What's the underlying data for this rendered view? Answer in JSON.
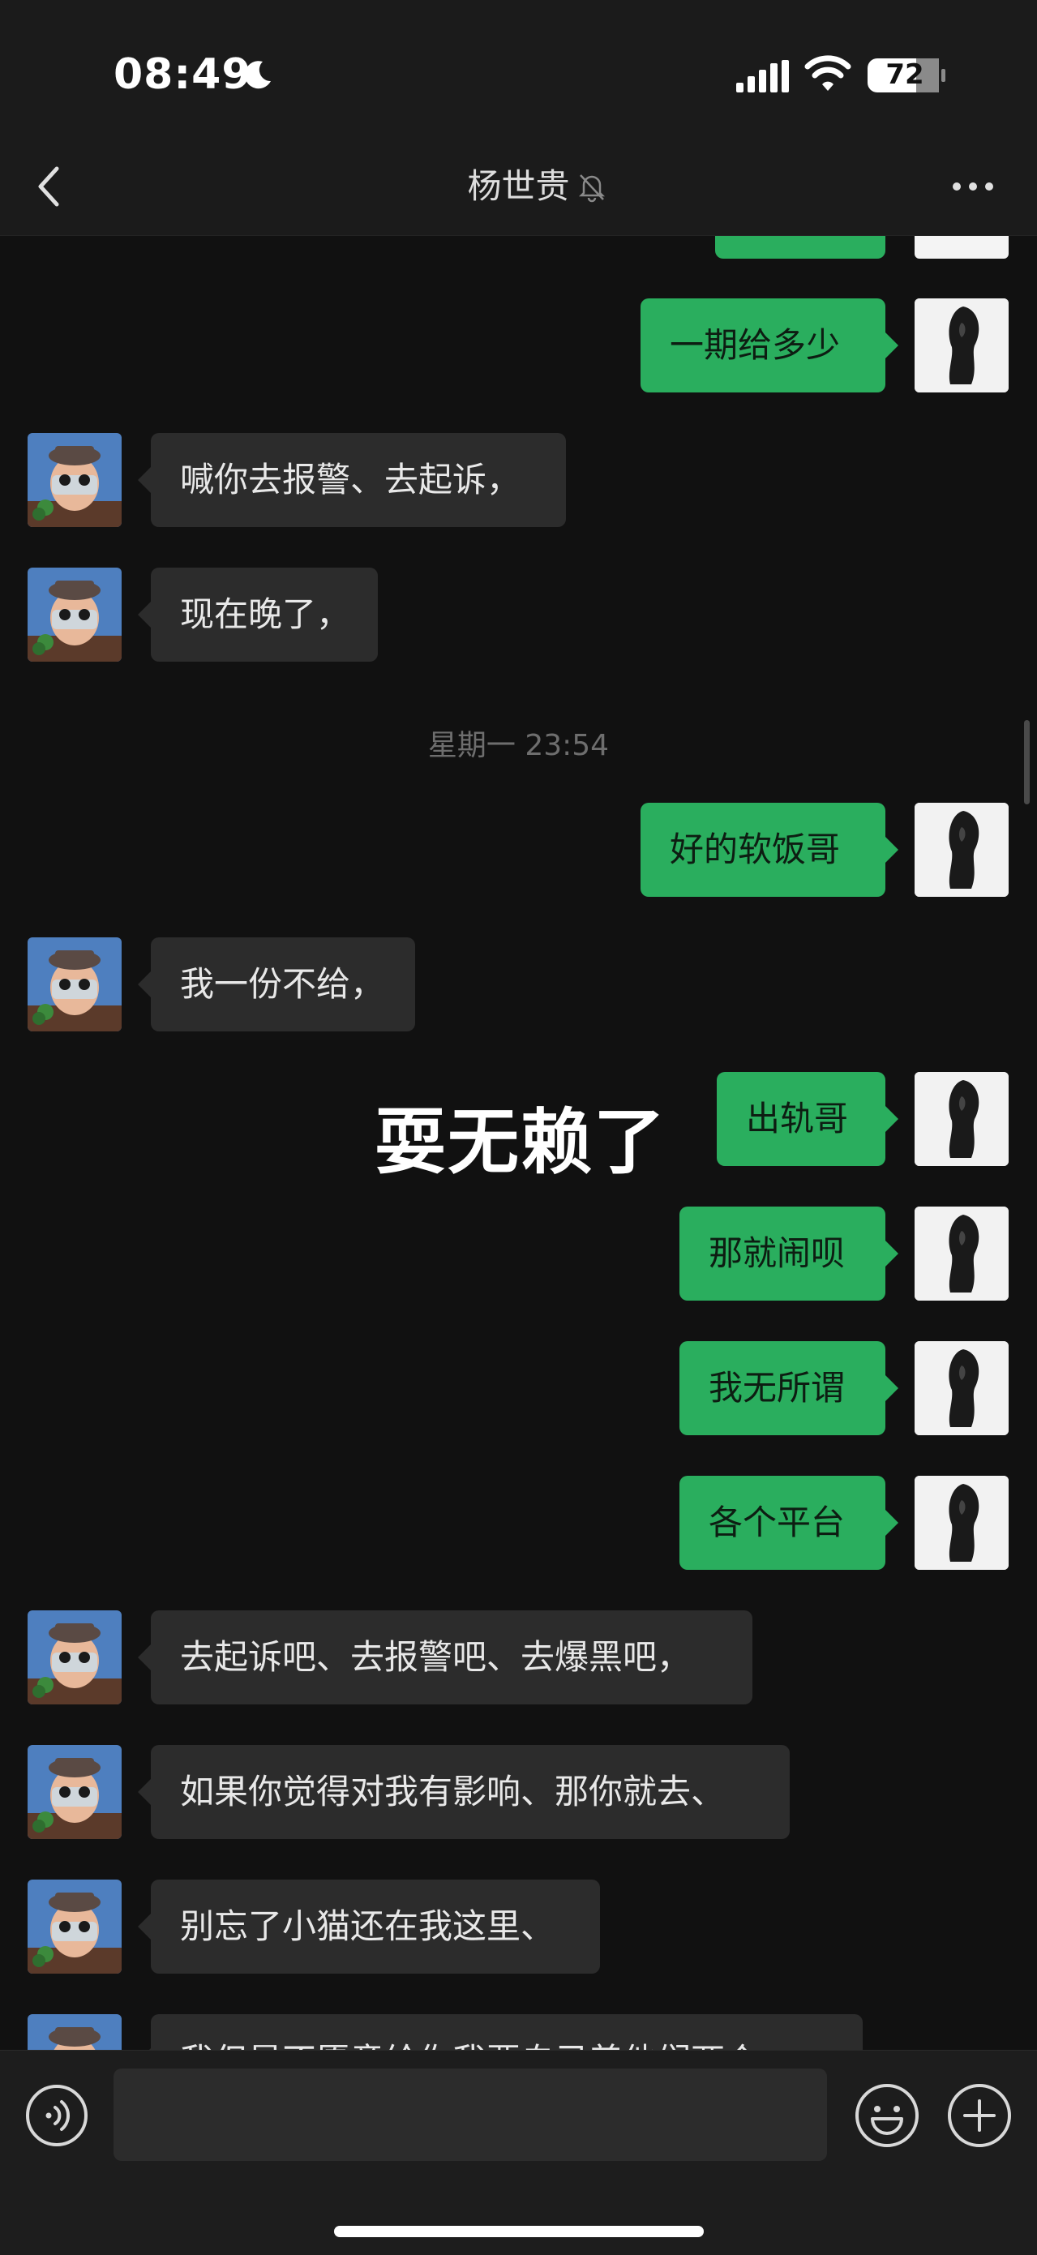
{
  "status_bar": {
    "time": "08:49",
    "battery": "72",
    "icons": [
      "moon-icon",
      "signal-icon",
      "wifi-icon",
      "battery-icon"
    ]
  },
  "header": {
    "title": "杨世贵",
    "back_icon": "chevron-left-icon",
    "mute_icon": "bell-off-icon",
    "more_icon": "more-horizontal-icon"
  },
  "timestamp": "星期一 23:54",
  "overlay_text": "耍无赖了",
  "messages": [
    {
      "side": "right",
      "text": "一期给多少"
    },
    {
      "side": "left",
      "text": "喊你去报警、去起诉，"
    },
    {
      "side": "left",
      "text": "现在晚了，"
    },
    {
      "side": "right",
      "text": "好的软饭哥"
    },
    {
      "side": "left",
      "text": "我一份不给，"
    },
    {
      "side": "right",
      "text": "出轨哥"
    },
    {
      "side": "right",
      "text": "那就闹呗"
    },
    {
      "side": "right",
      "text": "我无所谓"
    },
    {
      "side": "right",
      "text": "各个平台"
    },
    {
      "side": "left",
      "text": "去起诉吧、去报警吧、去爆黑吧，"
    },
    {
      "side": "left",
      "text": "如果你觉得对我有影响、那你就去、"
    },
    {
      "side": "left",
      "text": "别忘了小猫还在我这里、"
    },
    {
      "side": "left",
      "text": "我但是不愿意给你我要自己养他们两个"
    }
  ],
  "input_bar": {
    "placeholder": "",
    "icons": [
      "voice-icon",
      "emoji-icon",
      "plus-icon"
    ]
  },
  "colors": {
    "background": "#111111",
    "bubble_left": "#2c2c2c",
    "bubble_right": "#2aae5e",
    "timestamp": "#6e6e6e"
  }
}
